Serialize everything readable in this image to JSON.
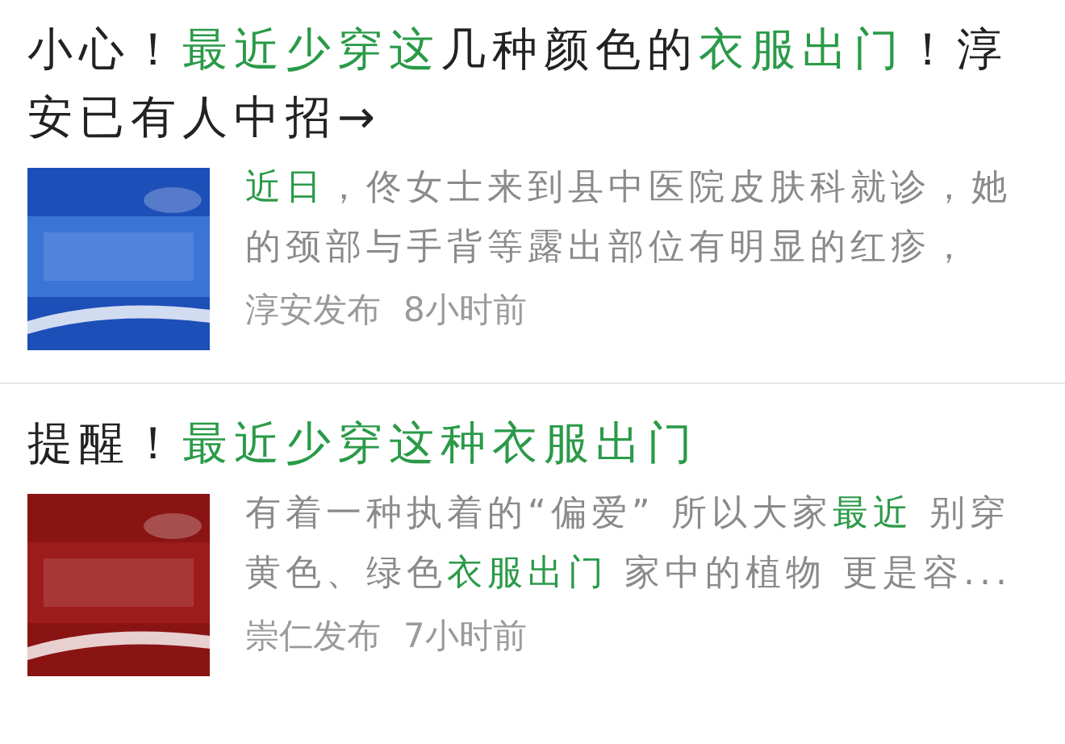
{
  "articles": [
    {
      "title": [
        {
          "text": "小心！",
          "highlight": false
        },
        {
          "text": "最近少穿这",
          "highlight": true
        },
        {
          "text": "几种颜色的",
          "highlight": false
        },
        {
          "text": "衣服出门",
          "highlight": true
        },
        {
          "text": "！淳安已有人中招→",
          "highlight": false
        }
      ],
      "summary": [
        {
          "text": "近日",
          "highlight": true
        },
        {
          "text": "，佟女士来到县中医院皮肤科就诊，她的颈部与手背等露出部位有明显的红疹，",
          "highlight": false
        }
      ],
      "source": "淳安发布",
      "time": "8小时前"
    },
    {
      "title": [
        {
          "text": "提醒！",
          "highlight": false
        },
        {
          "text": "最近少穿这种衣服出门",
          "highlight": true
        }
      ],
      "summary": [
        {
          "text": "有着一种执着的“偏爱” 所以大家",
          "highlight": false
        },
        {
          "text": "最近",
          "highlight": true
        },
        {
          "text": " 别穿黄色、绿色",
          "highlight": false
        },
        {
          "text": "衣服出门",
          "highlight": true
        },
        {
          "text": " 家中的植物 更是容...",
          "highlight": false
        }
      ],
      "source": "崇仁发布",
      "time": "7小时前"
    }
  ]
}
